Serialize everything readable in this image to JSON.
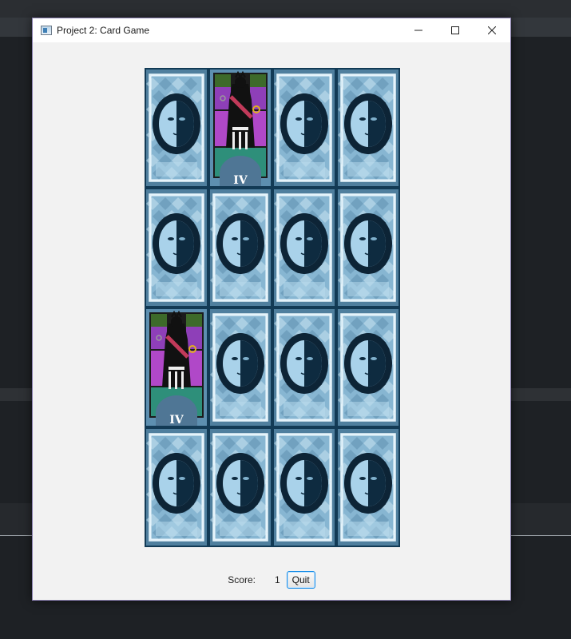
{
  "window": {
    "title": "Project 2: Card Game",
    "controls": {
      "minimize": "minimize-icon",
      "maximize": "maximize-icon",
      "close": "close-icon"
    }
  },
  "board": {
    "rows": 4,
    "cols": 4,
    "cards": [
      {
        "state": "face-down"
      },
      {
        "state": "face-up",
        "label": "IV"
      },
      {
        "state": "face-down"
      },
      {
        "state": "face-down"
      },
      {
        "state": "face-down"
      },
      {
        "state": "face-down"
      },
      {
        "state": "face-down"
      },
      {
        "state": "face-down"
      },
      {
        "state": "face-up",
        "label": "IV"
      },
      {
        "state": "face-down"
      },
      {
        "state": "face-down"
      },
      {
        "state": "face-down"
      },
      {
        "state": "face-down"
      },
      {
        "state": "face-down"
      },
      {
        "state": "face-down"
      },
      {
        "state": "face-down"
      }
    ]
  },
  "footer": {
    "score_label": "Score:",
    "score_value": "1",
    "quit_label": "Quit"
  },
  "colors": {
    "card_back_dark": "#123a55",
    "card_back_light": "#a9d2ea",
    "card_face_purple": "#8e3fb8",
    "card_face_teal": "#2e8f7a",
    "focus_blue": "#1e90e8"
  }
}
